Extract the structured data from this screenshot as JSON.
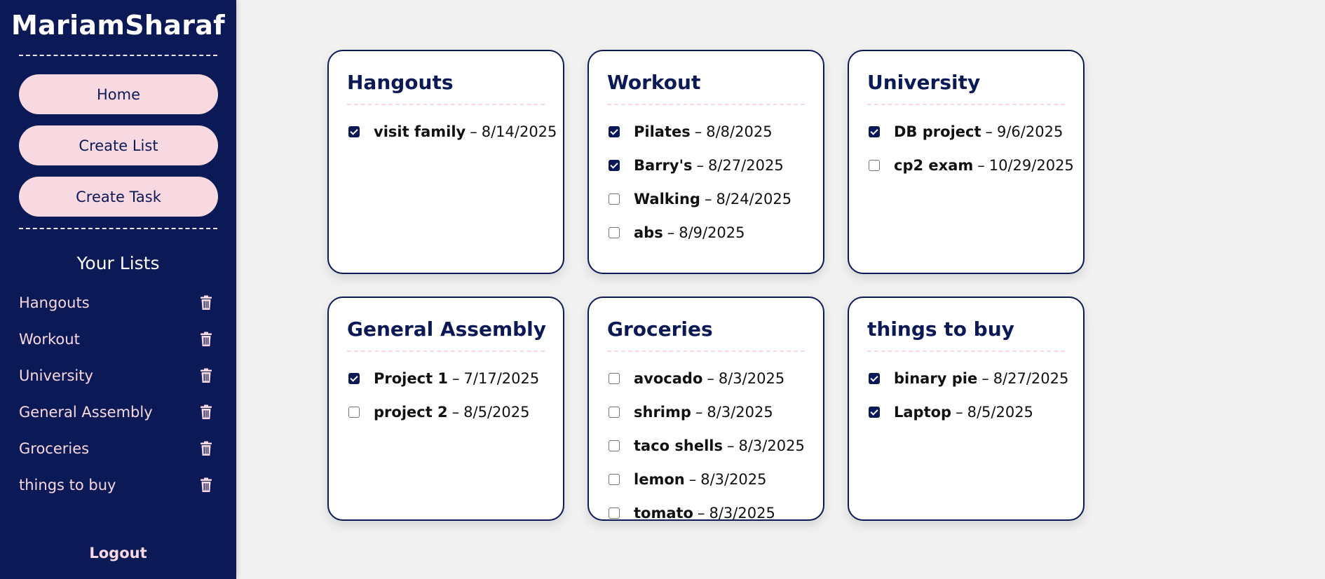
{
  "app": {
    "username": "MariamSharaf"
  },
  "nav": {
    "home": "Home",
    "create_list": "Create List",
    "create_task": "Create Task"
  },
  "sidebar": {
    "lists_title": "Your Lists",
    "lists": [
      {
        "label": "Hangouts",
        "icon": "trash-icon"
      },
      {
        "label": "Workout",
        "icon": "trash-icon"
      },
      {
        "label": "University",
        "icon": "trash-icon"
      },
      {
        "label": "General Assembly",
        "icon": "trash-icon"
      },
      {
        "label": "Groceries",
        "icon": "trash-icon"
      },
      {
        "label": "things to buy",
        "icon": "trash-icon"
      }
    ],
    "logout": "Logout"
  },
  "colors": {
    "navy": "#0b1957",
    "pink": "#f8d9e2",
    "background": "#f1f1f1"
  },
  "separator": "–",
  "cards": [
    {
      "title": "Hangouts",
      "tasks": [
        {
          "name": "visit family",
          "date": "8/14/2025",
          "done": true
        }
      ]
    },
    {
      "title": "Workout",
      "tasks": [
        {
          "name": "Pilates",
          "date": "8/8/2025",
          "done": true
        },
        {
          "name": "Barry's",
          "date": "8/27/2025",
          "done": true
        },
        {
          "name": "Walking",
          "date": "8/24/2025",
          "done": false
        },
        {
          "name": "abs",
          "date": "8/9/2025",
          "done": false
        }
      ]
    },
    {
      "title": "University",
      "tasks": [
        {
          "name": "DB project",
          "date": "9/6/2025",
          "done": true
        },
        {
          "name": "cp2 exam",
          "date": "10/29/2025",
          "done": false
        }
      ]
    },
    {
      "title": "General Assembly",
      "tasks": [
        {
          "name": "Project 1",
          "date": "7/17/2025",
          "done": true
        },
        {
          "name": "project 2",
          "date": "8/5/2025",
          "done": false
        }
      ]
    },
    {
      "title": "Groceries",
      "tasks": [
        {
          "name": "avocado",
          "date": "8/3/2025",
          "done": false
        },
        {
          "name": "shrimp",
          "date": "8/3/2025",
          "done": false
        },
        {
          "name": "taco shells",
          "date": "8/3/2025",
          "done": false
        },
        {
          "name": "lemon",
          "date": "8/3/2025",
          "done": false
        },
        {
          "name": "tomato",
          "date": "8/3/2025",
          "done": false
        }
      ]
    },
    {
      "title": "things to buy",
      "tasks": [
        {
          "name": "binary pie",
          "date": "8/27/2025",
          "done": true
        },
        {
          "name": "Laptop",
          "date": "8/5/2025",
          "done": true
        }
      ]
    }
  ]
}
